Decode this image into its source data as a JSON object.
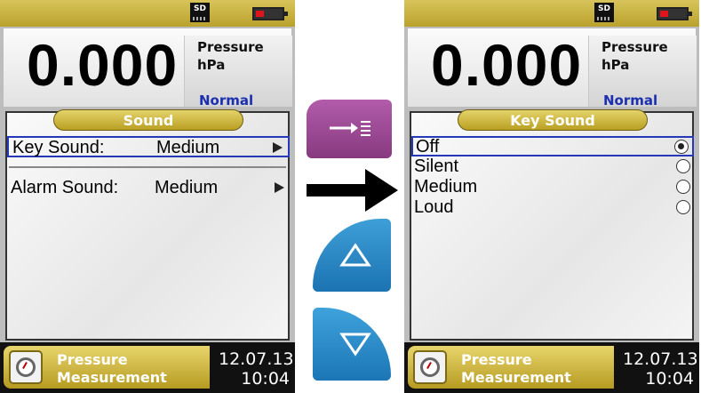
{
  "left_screen": {
    "sd_label": "SD",
    "reading": "0.000",
    "measurement_name": "Pressure",
    "unit": "hPa",
    "mode": "Normal",
    "menu_title": "Sound",
    "menu_items": [
      {
        "label": "Key Sound:",
        "value": "Medium"
      },
      {
        "label": "Alarm Sound:",
        "value": "Medium"
      }
    ],
    "bottom": {
      "line1": "Pressure",
      "line2": "Measurement",
      "date": "12.07.13",
      "time": "10:04"
    }
  },
  "right_screen": {
    "sd_label": "SD",
    "reading": "0.000",
    "measurement_name": "Pressure",
    "unit": "hPa",
    "mode": "Normal",
    "menu_title": "Key Sound",
    "options": [
      "Off",
      "Silent",
      "Medium",
      "Loud"
    ],
    "selected_option": "Off",
    "bottom": {
      "line1": "Pressure",
      "line2": "Measurement",
      "date": "12.07.13",
      "time": "10:04"
    }
  },
  "colors": {
    "accent_gold": "#c9b33e",
    "selection_blue": "#2438b8",
    "enter_key": "#9c4a94",
    "nav_key": "#2a86c4"
  },
  "icons": {
    "enter_key_icon": "enter-list-icon",
    "up_key_icon": "triangle-up-icon",
    "down_key_icon": "triangle-down-icon",
    "flow_icon": "right-arrow-icon"
  }
}
